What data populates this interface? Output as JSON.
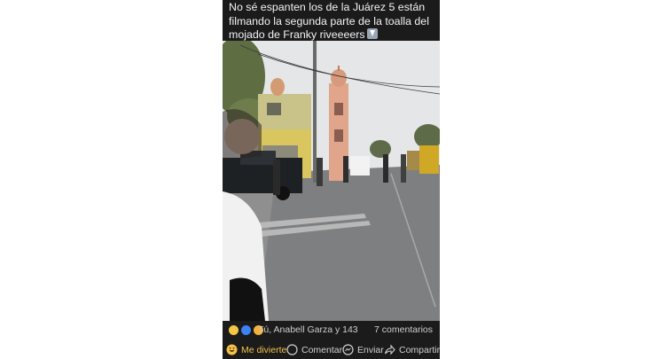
{
  "post": {
    "caption": "No sé espanten los de la Juárez 5 están filmando la segunda parte de la toalla del mojado de Franky riveeeers",
    "caption_emoji_icon": "down-arrow-emoji"
  },
  "reactions": {
    "emoji_icons": [
      "haha",
      "like",
      "wow"
    ],
    "reactors_text": "Tú, Anabell Garza y 143",
    "comments_text": "7 comentarios"
  },
  "actions": {
    "reaction_label": "Me divierte",
    "comment_label": "Comentar",
    "send_label": "Enviar",
    "share_label": "Compartir"
  },
  "colors": {
    "background": "#ffffff",
    "post_background": "#1b1b1b",
    "reaction_active": "#f3c14b"
  }
}
